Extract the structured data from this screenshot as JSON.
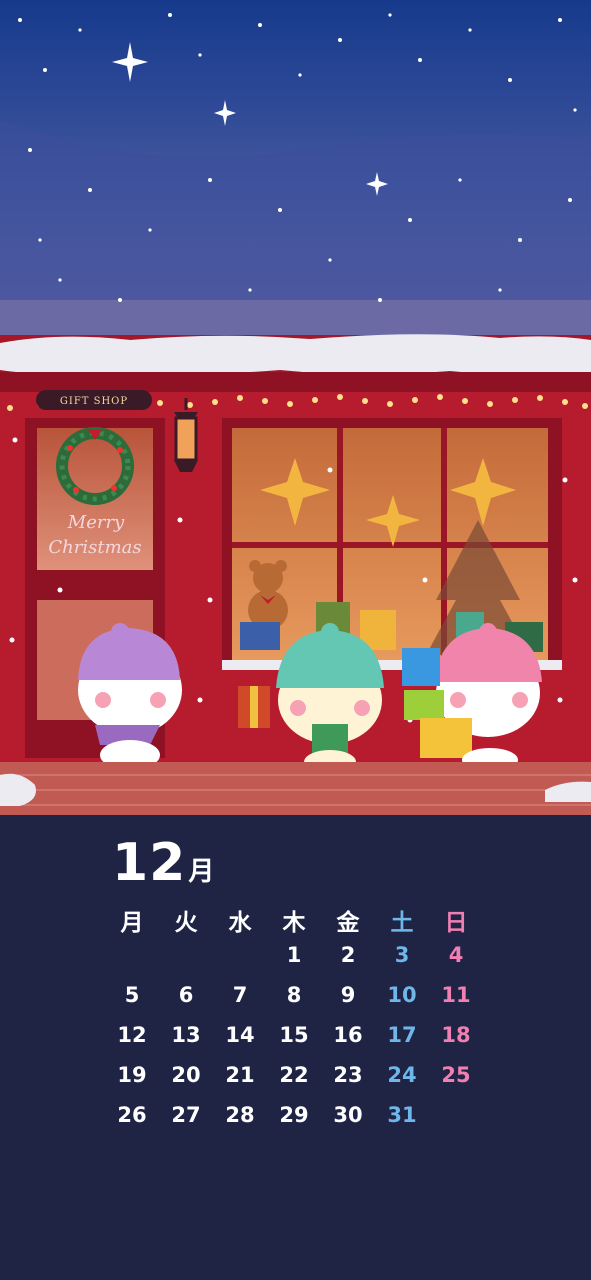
{
  "scene": {
    "shop_sign": "GIFT SHOP",
    "door_text_line1": "Merry",
    "door_text_line2": "Christmas"
  },
  "calendar": {
    "month_number": "12",
    "month_unit": "月",
    "weekdays": [
      "月",
      "火",
      "水",
      "木",
      "金",
      "土",
      "日"
    ],
    "weeks": [
      [
        "",
        "",
        "",
        "1",
        "2",
        "3",
        "4"
      ],
      [
        "5",
        "6",
        "7",
        "8",
        "9",
        "10",
        "11"
      ],
      [
        "12",
        "13",
        "14",
        "15",
        "16",
        "17",
        "18"
      ],
      [
        "19",
        "20",
        "21",
        "22",
        "23",
        "24",
        "25"
      ],
      [
        "26",
        "27",
        "28",
        "29",
        "30",
        "31",
        ""
      ]
    ]
  },
  "colors": {
    "sky_top": "#1a3b8e",
    "sky_bottom": "#6e6ca8",
    "shop_red": "#b71c2e",
    "calendar_bg": "#1f2445",
    "saturday": "#6fb6ea",
    "sunday": "#f07fb2"
  }
}
